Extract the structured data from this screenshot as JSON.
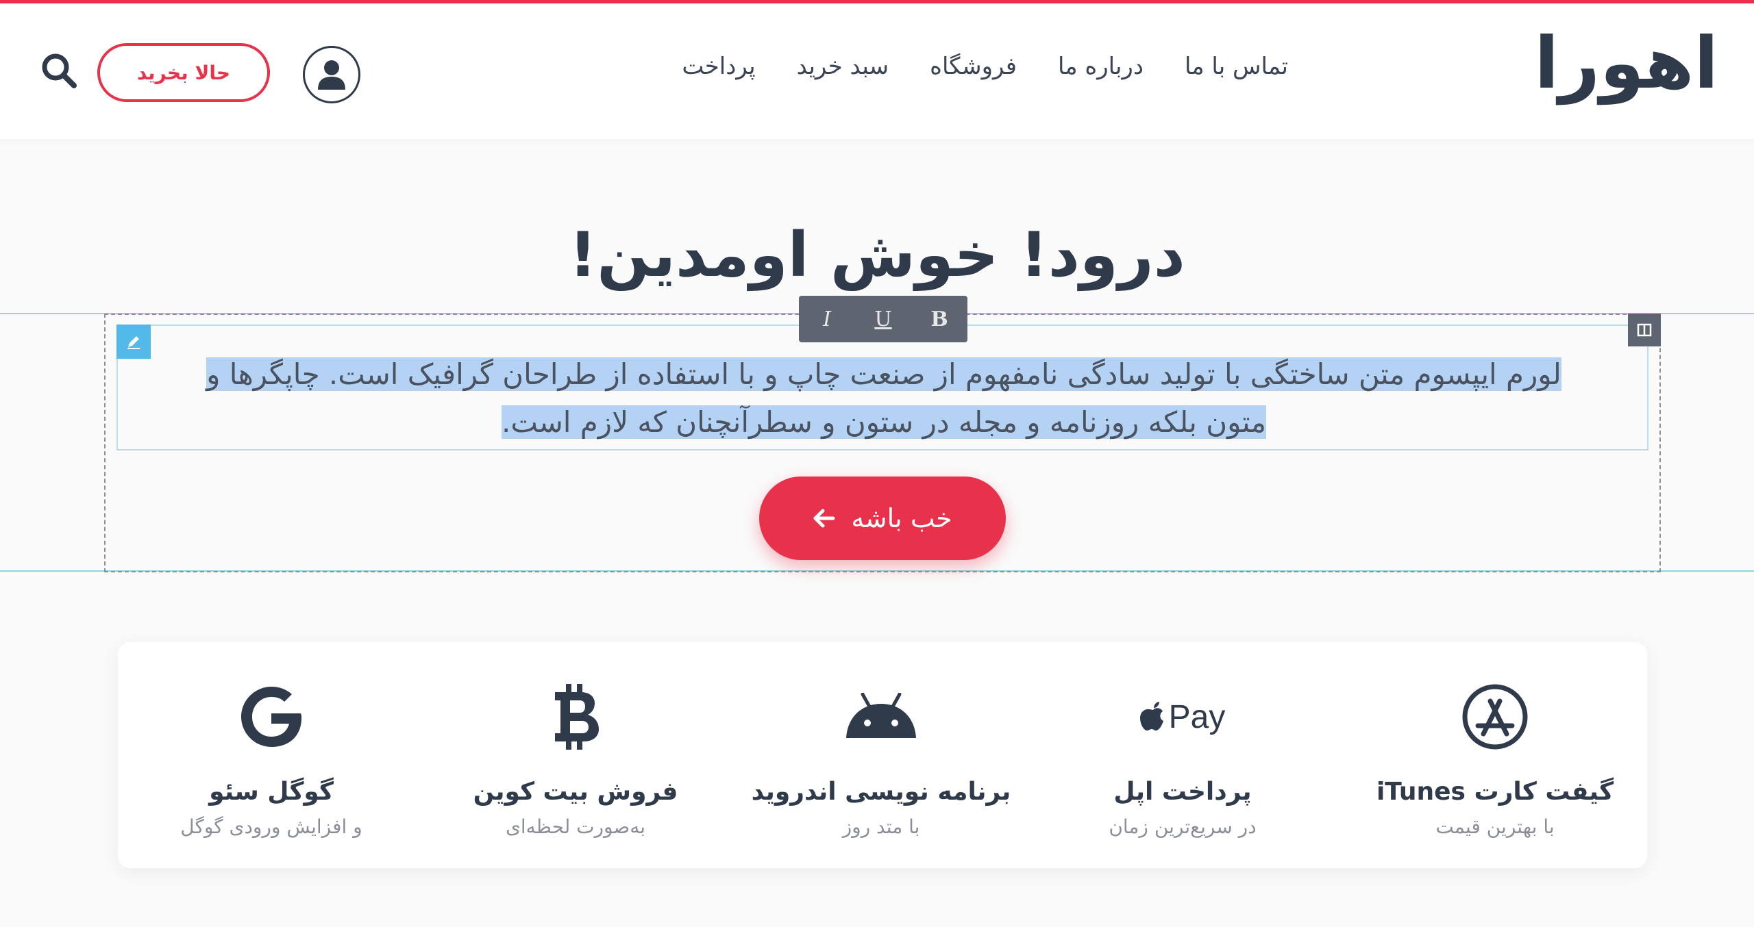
{
  "colors": {
    "accent": "#e8314a",
    "text": "#2f3a4a",
    "selection": "#b4d3f4",
    "guide": "#8fd3e6"
  },
  "header": {
    "logo": "اهورا",
    "nav": [
      "پرداخت",
      "سبد خرید",
      "فروشگاه",
      "درباره ما",
      "تماس با ما"
    ],
    "buy_button": "حالا بخرید",
    "icons": {
      "search": "search-icon",
      "user": "user-icon"
    }
  },
  "hero": {
    "title": "درود! خوش اومدین!",
    "paragraph_line1": "لورم ایپسوم متن ساختگی با تولید سادگی نامفهوم از صنعت چاپ و با استفاده از طراحان گرافیک است. چاپگرها و",
    "paragraph_line2": "متون بلکه روزنامه و مجله در ستون و سطرآنچنان که لازم است.",
    "cta_label": "خب باشه"
  },
  "editor_toolbar": {
    "italic": "I",
    "underline": "U",
    "bold": "B"
  },
  "features": [
    {
      "icon": "app-store-icon",
      "title": "گیفت کارت iTunes",
      "subtitle": "با بهترین قیمت"
    },
    {
      "icon": "apple-pay-icon",
      "icon_text": "Pay",
      "title": "پرداخت اپل",
      "subtitle": "در سریع‌ترین زمان"
    },
    {
      "icon": "android-icon",
      "title": "برنامه نویسی اندروید",
      "subtitle": "با متد روز"
    },
    {
      "icon": "bitcoin-icon",
      "title": "فروش بیت کوین",
      "subtitle": "به‌صورت لحظه‌ای"
    },
    {
      "icon": "google-icon",
      "title": "گوگل سئو",
      "subtitle": "و افزایش ورودی گوگل"
    }
  ]
}
